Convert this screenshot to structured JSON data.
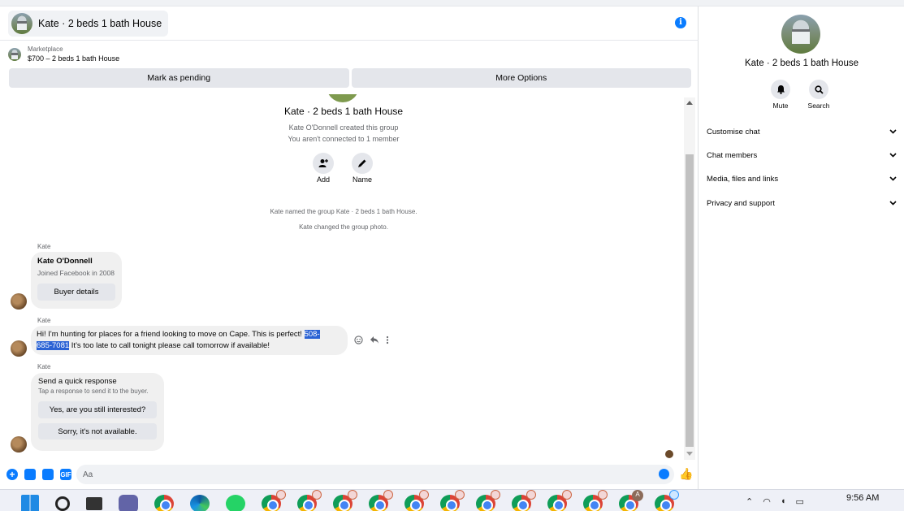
{
  "header": {
    "title": "Kate · 2 beds 1 bath House",
    "info_icon": "i"
  },
  "marketplace": {
    "label": "Marketplace",
    "listing": "$700 – 2 beds 1 bath House"
  },
  "actions": {
    "mark_pending": "Mark as pending",
    "more_options": "More Options"
  },
  "group": {
    "title": "Kate · 2 beds 1 bath House",
    "created_by": "Kate O'Donnell created this group",
    "connection": "You aren't connected to 1 member",
    "add_label": "Add",
    "name_label": "Name"
  },
  "system_messages": [
    "Kate named the group Kate · 2 beds 1 bath House.",
    "Kate changed the group photo."
  ],
  "messages": {
    "sender": "Kate",
    "profile_card": {
      "name": "Kate O'Donnell",
      "joined": "Joined Facebook in 2008",
      "button": "Buyer details"
    },
    "text_before": "Hi! I'm hunting for places for a friend looking to move on Cape. This is perfect! ",
    "phone_part1": "508-",
    "phone_part2": "685-7081",
    "text_after": " It's too late to call tonight please call tomorrow if available!",
    "quick": {
      "title": "Send a quick response",
      "subtitle": "Tap a response to send it to the buyer.",
      "option1": "Yes, are you still interested?",
      "option2": "Sorry, it's not available."
    }
  },
  "composer": {
    "placeholder": "Aa",
    "gif": "GIF"
  },
  "side": {
    "title": "Kate · 2 beds 1 bath House",
    "mute": "Mute",
    "search": "Search",
    "menu": [
      "Customise chat",
      "Chat members",
      "Media, files and links",
      "Privacy and support"
    ]
  },
  "taskbar": {
    "time": "9:56 AM",
    "badge_letter": "A"
  },
  "colors": {
    "accent": "#0a7cff",
    "highlight": "#2a62d4",
    "bubble": "#f0f0f0"
  }
}
